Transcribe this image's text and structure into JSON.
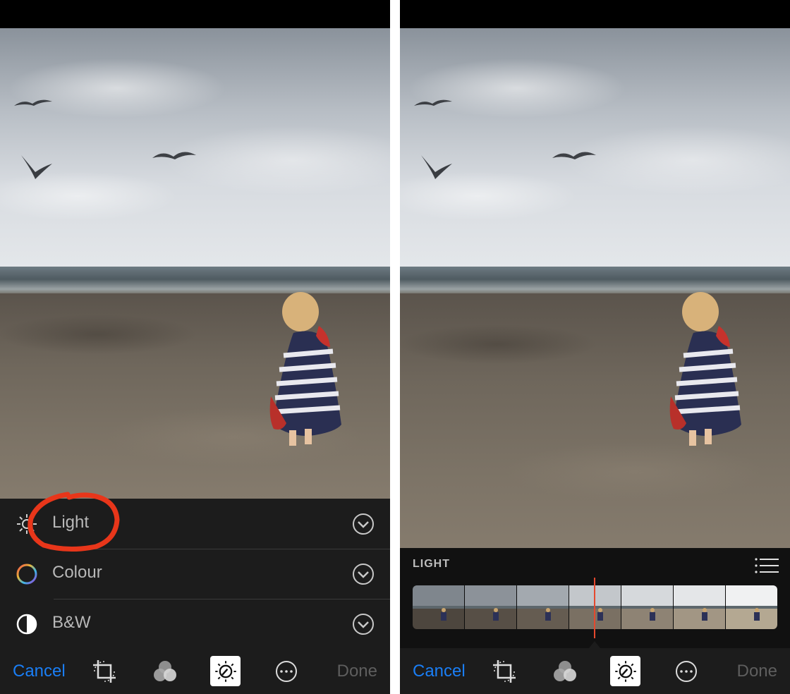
{
  "left_screen": {
    "adjustments": [
      {
        "label": "Light",
        "icon": "sun-icon"
      },
      {
        "label": "Colour",
        "icon": "color-wheel-icon"
      },
      {
        "label": "B&W",
        "icon": "half-circle-icon"
      }
    ],
    "annotation_color": "#e8361a"
  },
  "right_screen": {
    "panel_title": "LIGHT",
    "list_icon": "list-icon",
    "playhead_color": "#e5482e"
  },
  "toolbar": {
    "cancel_label": "Cancel",
    "done_label": "Done",
    "cancel_color": "#1a7ef5",
    "done_color": "#5e5e5e",
    "icons": [
      "crop-rotate-icon",
      "filters-icon",
      "adjust-dial-icon",
      "more-icon"
    ],
    "active_icon": "adjust-dial-icon"
  }
}
